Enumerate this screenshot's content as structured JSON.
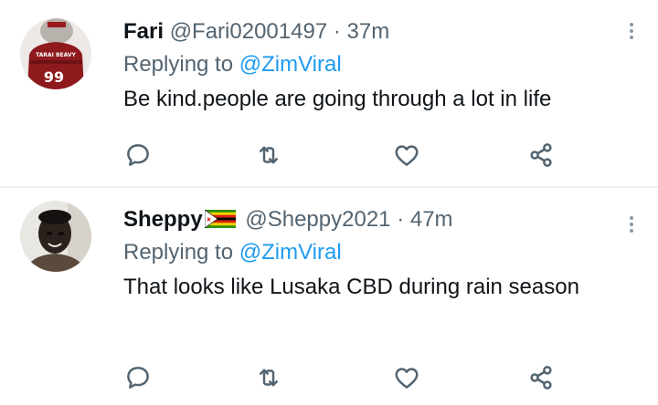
{
  "tweets": [
    {
      "name": "Fari",
      "handle": "@Fari02001497",
      "separator": "·",
      "time": "37m",
      "replying_prefix": "Replying to",
      "replying_to": "@ZimViral",
      "text": "Be kind.people are going through a lot in life",
      "avatar_jersey_text": "TARAI BEAVY",
      "avatar_jersey_number": "99"
    },
    {
      "name": "Sheppy",
      "handle": "@Sheppy2021",
      "separator": "·",
      "time": "47m",
      "replying_prefix": "Replying to",
      "replying_to": "@ZimViral",
      "text": "That looks like Lusaka CBD during rain season"
    }
  ],
  "icons": {
    "reply": "reply-icon",
    "retweet": "retweet-icon",
    "like": "like-icon",
    "share": "share-icon",
    "more": "more-icon",
    "flag": "zimbabwe-flag-icon"
  },
  "colors": {
    "text": "#0f1419",
    "secondary": "#536471",
    "link": "#1d9bf0"
  }
}
